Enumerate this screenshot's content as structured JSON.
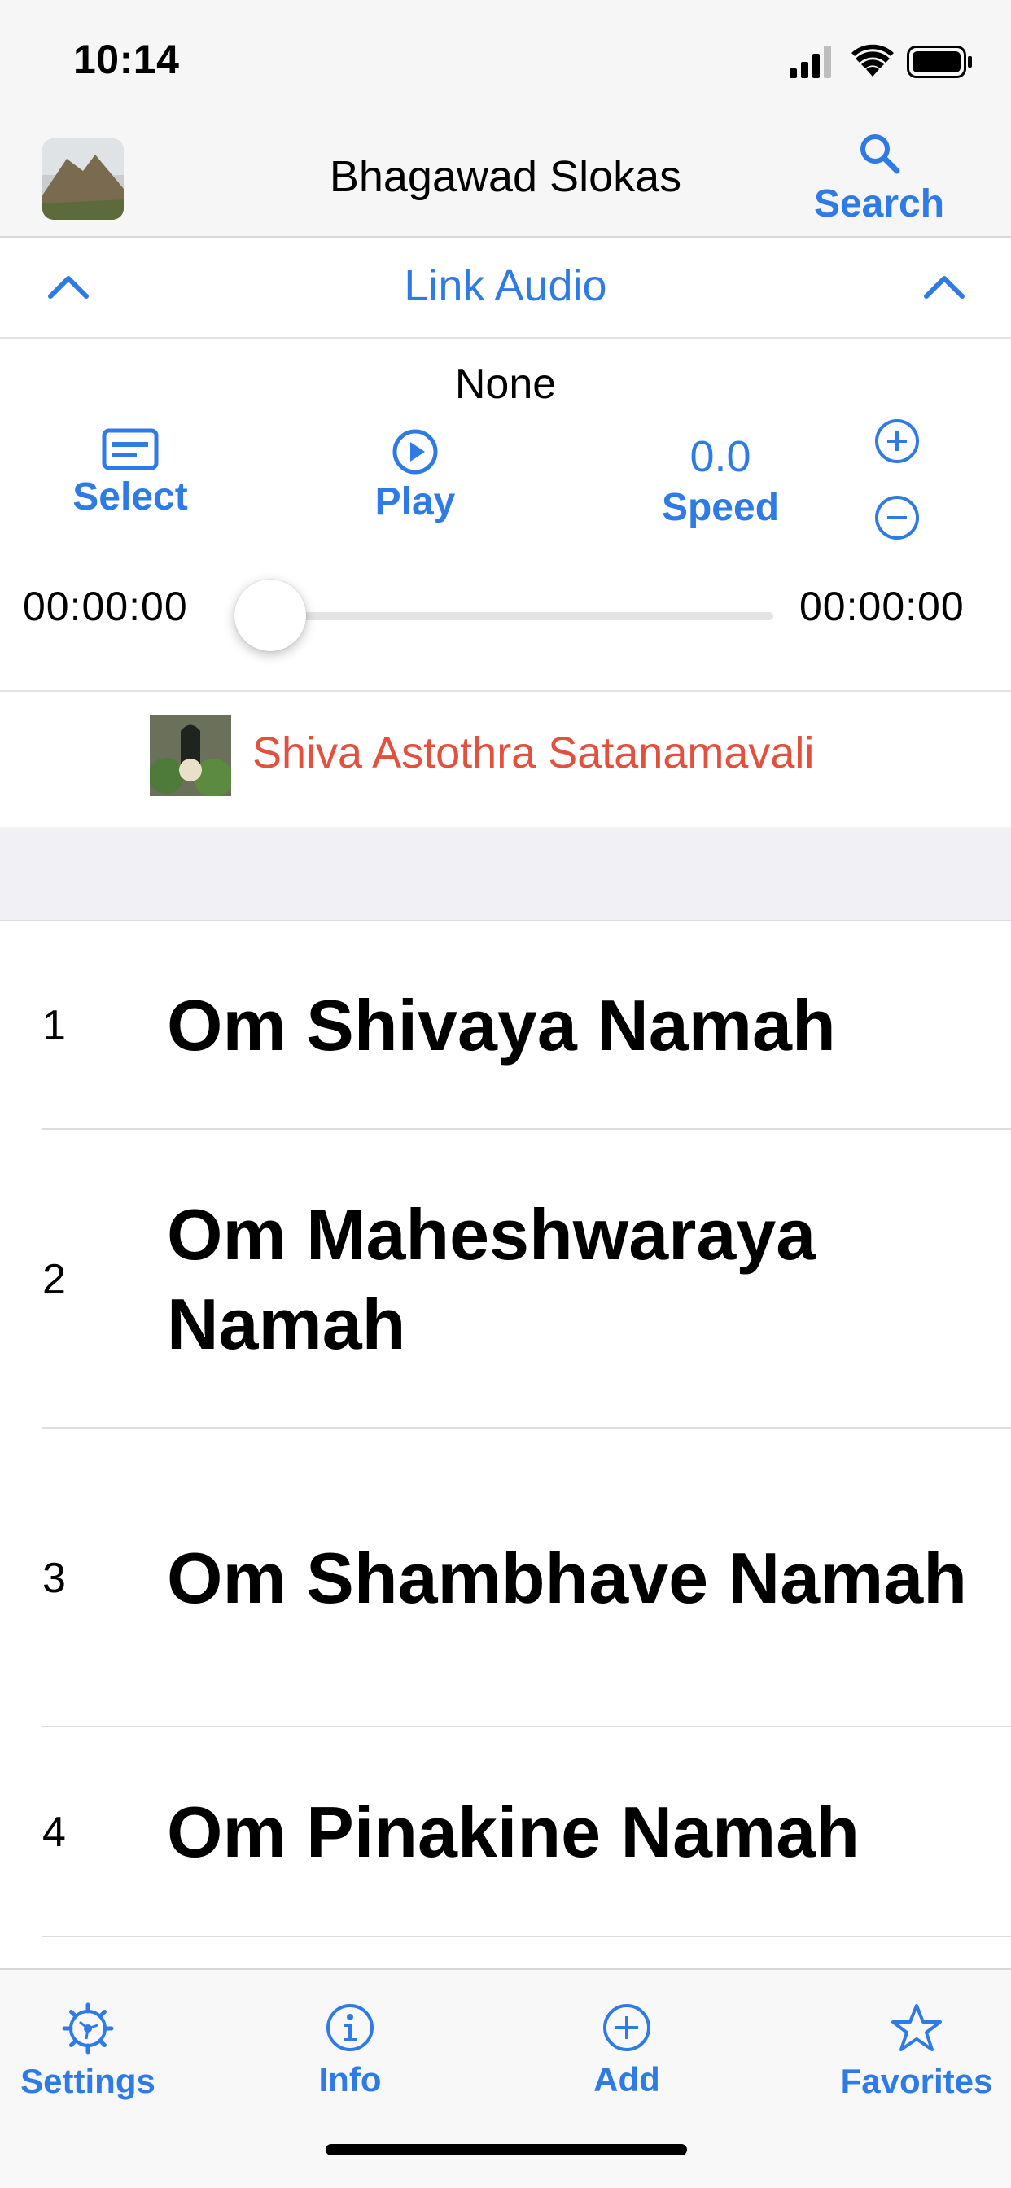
{
  "status_bar": {
    "time": "10:14"
  },
  "nav": {
    "title": "Bhagawad Slokas",
    "search_label": "Search",
    "search_icon": "magnifier-icon"
  },
  "link_bar": {
    "title": "Link Audio"
  },
  "player": {
    "audio_name": "None",
    "select_label": "Select",
    "play_label": "Play",
    "speed_value": "0.0",
    "speed_label": "Speed",
    "elapsed": "00:00:00",
    "duration": "00:00:00",
    "progress": 0
  },
  "title_row": {
    "title": "Shiva Astothra Satanamavali"
  },
  "slokas": [
    {
      "num": "1",
      "text": "Om Shivaya Namah"
    },
    {
      "num": "2",
      "text": "Om Maheshwaraya Namah"
    },
    {
      "num": "3",
      "text": "Om Shambhave Namah"
    },
    {
      "num": "4",
      "text": "Om Pinakine Namah"
    }
  ],
  "tabs": [
    {
      "label": "Settings",
      "icon": "gear-icon"
    },
    {
      "label": "Info",
      "icon": "info-icon"
    },
    {
      "label": "Add",
      "icon": "plus-circle-icon"
    },
    {
      "label": "Favorites",
      "icon": "star-icon"
    }
  ],
  "colors": {
    "accent": "#2f7be5",
    "title_red": "#e2503e"
  }
}
